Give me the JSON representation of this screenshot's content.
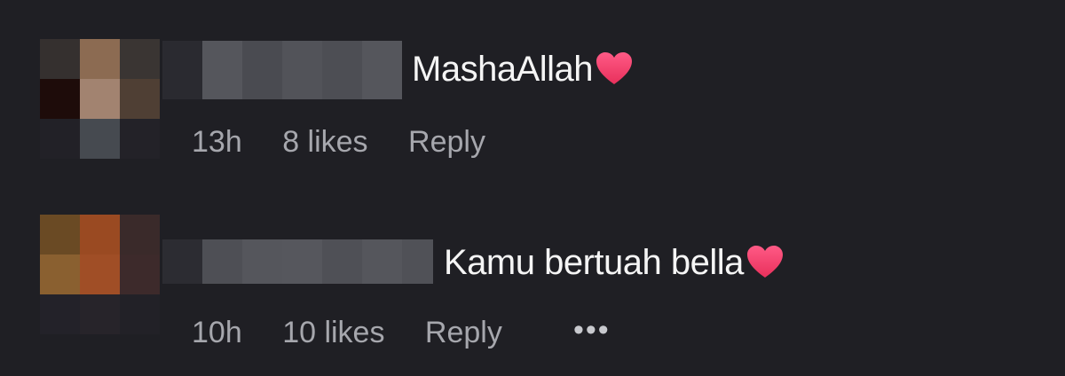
{
  "comments": [
    {
      "text": "MashaAllah",
      "emoji": "heart-emoji",
      "time": "13h",
      "likes": "8 likes",
      "reply_label": "Reply"
    },
    {
      "text": "Kamu bertuah bella",
      "emoji": "heart-emoji",
      "time": "10h",
      "likes": "10 likes",
      "reply_label": "Reply",
      "more": "•••"
    }
  ],
  "colors": {
    "background": "#1f1f24",
    "text": "#f5f5f5",
    "meta": "#a6a7ad",
    "heart": "#f2446f"
  }
}
